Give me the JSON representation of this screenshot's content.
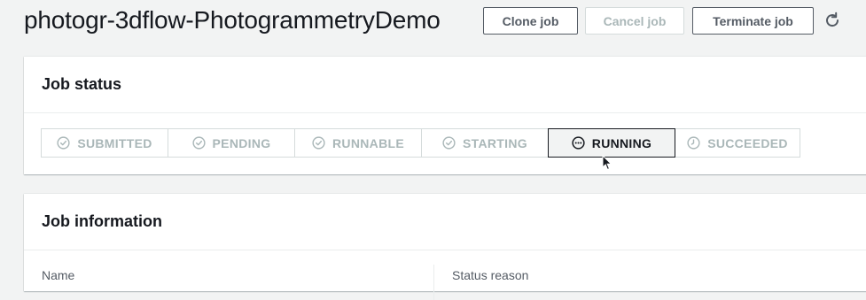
{
  "header": {
    "title": "photogr-3dflow-PhotogrammetryDemo",
    "clone_label": "Clone job",
    "cancel_label": "Cancel job",
    "terminate_label": "Terminate job",
    "refresh_icon": "refresh-icon"
  },
  "job_status": {
    "heading": "Job status",
    "steps": [
      {
        "label": "SUBMITTED",
        "icon": "check-circle-icon",
        "state": "done"
      },
      {
        "label": "PENDING",
        "icon": "check-circle-icon",
        "state": "done"
      },
      {
        "label": "RUNNABLE",
        "icon": "check-circle-icon",
        "state": "done"
      },
      {
        "label": "STARTING",
        "icon": "check-circle-icon",
        "state": "done"
      },
      {
        "label": "RUNNING",
        "icon": "in-progress-icon",
        "state": "current"
      },
      {
        "label": "SUCCEEDED",
        "icon": "clock-icon",
        "state": "upcoming"
      }
    ]
  },
  "job_information": {
    "heading": "Job information",
    "name_label": "Name",
    "status_reason_label": "Status reason"
  },
  "colors": {
    "background": "#f2f3f3",
    "text": "#16191f",
    "muted": "#aab7b8",
    "border": "#d5dbdb"
  }
}
